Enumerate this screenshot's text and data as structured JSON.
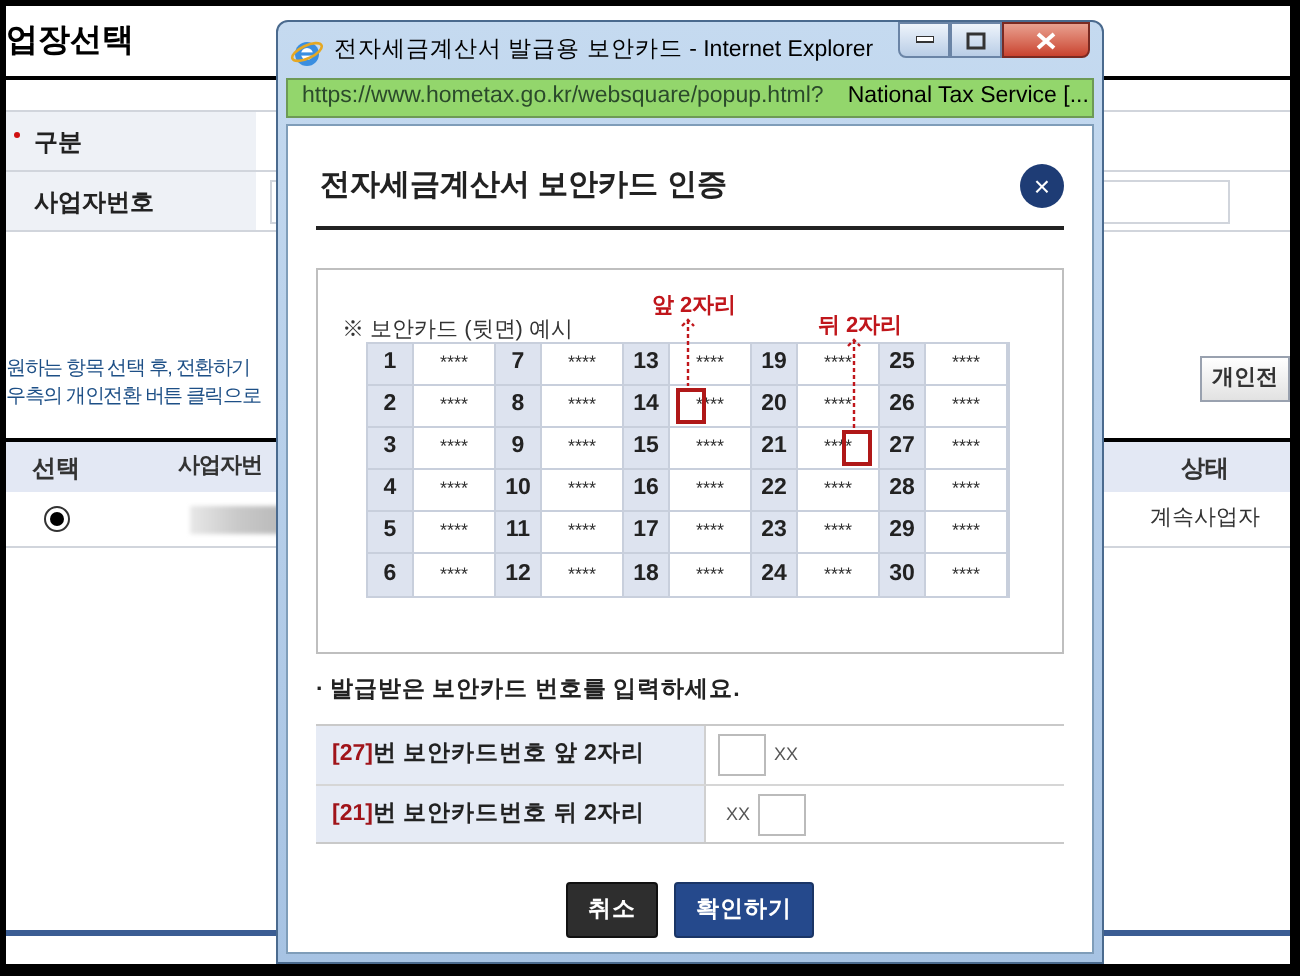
{
  "page": {
    "title": "업장선택",
    "form": [
      {
        "label": "구분",
        "required": true,
        "kind": "plain"
      },
      {
        "label": "사업자번호",
        "required": false,
        "kind": "input"
      }
    ],
    "instructions": [
      "원하는 항목 선택 후, 전환하기",
      "우측의 개인전환 버튼 클릭으로"
    ],
    "convert_button": "개인전",
    "table": {
      "columns": [
        "선택",
        "사업자번",
        "상태"
      ],
      "rows": [
        {
          "selected": true,
          "status": "계속사업자"
        }
      ]
    }
  },
  "popup": {
    "window_title": "전자세금계산서 발급용 보안카드 - Internet Explorer",
    "url": "https://www.hometax.go.kr/websquare/popup.html?",
    "site_identity": "National Tax Service [...",
    "heading": "전자세금계산서 보안카드 인증",
    "close": "×",
    "card": {
      "caption": "※ 보안카드 (뒷면) 예시",
      "labels": [
        {
          "text": "앞 2자리",
          "kind": "front"
        },
        {
          "text": "뒤 2자리",
          "kind": "back"
        }
      ],
      "rows": [
        {
          "cells": [
            {
              "number": "1",
              "value": "****",
              "highlighted": false
            },
            {
              "number": "7",
              "value": "****",
              "highlighted": false
            },
            {
              "number": "13",
              "value": "****",
              "highlighted": false
            },
            {
              "number": "19",
              "value": "****",
              "highlighted": false
            },
            {
              "number": "25",
              "value": "****",
              "highlighted": false
            }
          ]
        },
        {
          "cells": [
            {
              "number": "2",
              "value": "****",
              "highlighted": false
            },
            {
              "number": "8",
              "value": "****",
              "highlighted": false
            },
            {
              "number": "14",
              "value": "****",
              "highlighted": true
            },
            {
              "number": "20",
              "value": "****",
              "highlighted": false
            },
            {
              "number": "26",
              "value": "****",
              "highlighted": false
            }
          ]
        },
        {
          "cells": [
            {
              "number": "3",
              "value": "****",
              "highlighted": false
            },
            {
              "number": "9",
              "value": "****",
              "highlighted": false
            },
            {
              "number": "15",
              "value": "****",
              "highlighted": false
            },
            {
              "number": "21",
              "value": "****",
              "highlighted": true
            },
            {
              "number": "27",
              "value": "****",
              "highlighted": false
            }
          ]
        },
        {
          "cells": [
            {
              "number": "4",
              "value": "****",
              "highlighted": false
            },
            {
              "number": "10",
              "value": "****",
              "highlighted": false
            },
            {
              "number": "16",
              "value": "****",
              "highlighted": false
            },
            {
              "number": "22",
              "value": "****",
              "highlighted": false
            },
            {
              "number": "28",
              "value": "****",
              "highlighted": false
            }
          ]
        },
        {
          "cells": [
            {
              "number": "5",
              "value": "****",
              "highlighted": false
            },
            {
              "number": "11",
              "value": "****",
              "highlighted": false
            },
            {
              "number": "17",
              "value": "****",
              "highlighted": false
            },
            {
              "number": "23",
              "value": "****",
              "highlighted": false
            },
            {
              "number": "29",
              "value": "****",
              "highlighted": false
            }
          ]
        },
        {
          "cells": [
            {
              "number": "6",
              "value": "****",
              "highlighted": false
            },
            {
              "number": "12",
              "value": "****",
              "highlighted": false
            },
            {
              "number": "18",
              "value": "****",
              "highlighted": false
            },
            {
              "number": "24",
              "value": "****",
              "highlighted": false
            },
            {
              "number": "30",
              "value": "****",
              "highlighted": false
            }
          ]
        }
      ]
    },
    "instruction": "· 발급받은 보안카드 번호를 입력하세요.",
    "entries": [
      {
        "index": "[27]",
        "label": "번 보안카드번호 앞 2자리",
        "kind": "first",
        "mask": "XX"
      },
      {
        "index": "[21]",
        "label": "번 보안카드번호 뒤 2자리",
        "kind": "last",
        "mask": "XX"
      }
    ],
    "buttons": [
      {
        "label": "취소",
        "kind": "cancel"
      },
      {
        "label": "확인하기",
        "kind": "confirm"
      }
    ]
  }
}
